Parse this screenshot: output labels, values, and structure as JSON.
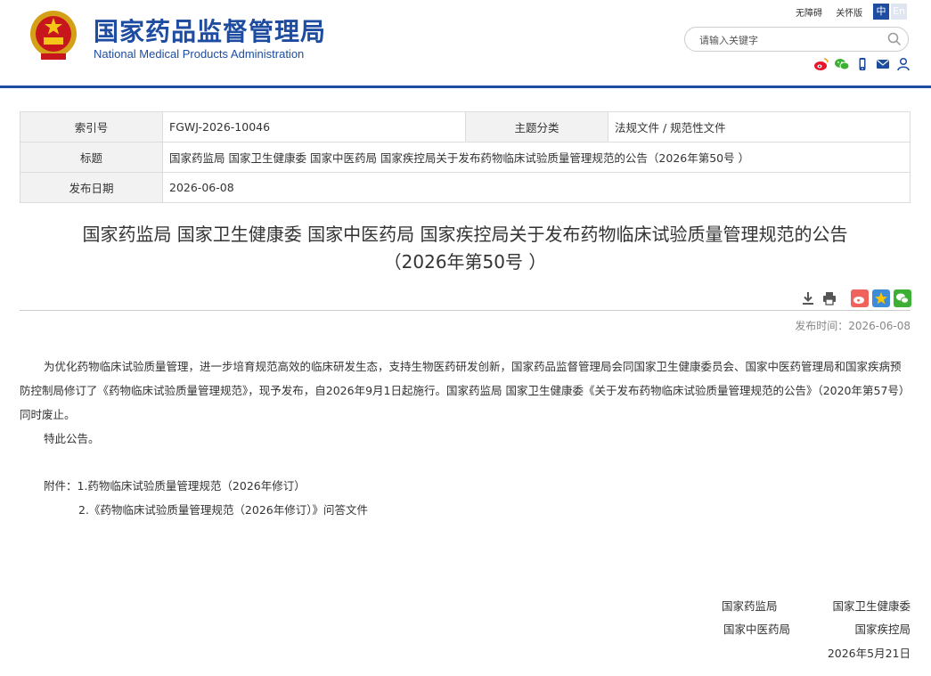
{
  "header": {
    "site_name_cn": "国家药品监督管理局",
    "site_name_en": "National Medical Products Administration",
    "accessibility_link": "无障碍",
    "care_version_link": "关怀版",
    "lang_zh": "中",
    "lang_en": "En",
    "search_placeholder": "请输入关键字",
    "social_icons": [
      "weibo-icon",
      "wechat-icon",
      "mobile-icon",
      "mail-icon",
      "user-icon"
    ],
    "brand_color": "#1e4ca1"
  },
  "meta": {
    "index_label": "索引号",
    "index_value": "FGWJ-2026-10046",
    "category_label": "主题分类",
    "category_value": "法规文件 / 规范性文件",
    "title_label": "标题",
    "title_value": "国家药监局 国家卫生健康委 国家中医药局 国家疾控局关于发布药物临床试验质量管理规范的公告（2026年第50号 ）",
    "date_label": "发布日期",
    "date_value": "2026-06-08"
  },
  "article": {
    "title_line1": "国家药监局 国家卫生健康委 国家中医药局 国家疾控局关于发布药物临床试验质量管理规范的公告",
    "title_line2": "（2026年第50号 ）",
    "publish_time": "发布时间：2026-06-08",
    "paragraph1": "为优化药物临床试验质量管理，进一步培育规范高效的临床研发生态，支持生物医药研发创新，国家药品监督管理局会同国家卫生健康委员会、国家中医药管理局和国家疾病预防控制局修订了《药物临床试验质量管理规范》，现予发布，自2026年9月1日起施行。国家药监局 国家卫生健康委《关于发布药物临床试验质量管理规范的公告》（2020年第57号）同时废止。",
    "paragraph2": "特此公告。",
    "attachment1": "附件：1.药物临床试验质量管理规范（2026年修订）",
    "attachment2": "2.《药物临床试验质量管理规范（2026年修订）》问答文件",
    "sign1": "国家药监局",
    "sign2": "国家卫生健康委",
    "sign3": "国家中医药局",
    "sign4": "国家疾控局",
    "sign_date": "2026年5月21日"
  }
}
